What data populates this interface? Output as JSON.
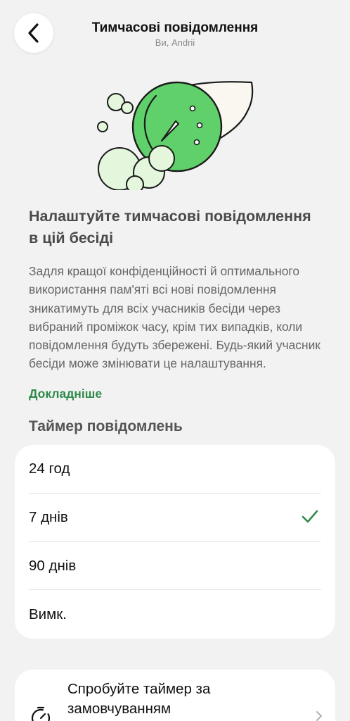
{
  "header": {
    "title": "Тимчасові повідомлення",
    "subtitle": "Ви, Andrii"
  },
  "intro": {
    "heading": "Налаштуйте тимчасові повідомлення в цій бесіді",
    "body": "Задля кращої конфіденційності й оптимального використання пам'яті всі нові повідомлення зникатимуть для всіх учасників бесіди через вибраний проміжок часу, крім тих випадків, коли повідомлення будуть збережені. Будь-який учасник бесіди може змінювати це налаштування.",
    "learn_more": "Докладніше"
  },
  "timer": {
    "heading": "Таймер повідомлень",
    "options": [
      {
        "label": "24 год",
        "selected": false
      },
      {
        "label": "7 днів",
        "selected": true
      },
      {
        "label": "90 днів",
        "selected": false
      },
      {
        "label": "Вимк.",
        "selected": false
      }
    ]
  },
  "default_timer": {
    "label": "Спробуйте таймер за замовчуванням"
  },
  "colors": {
    "accent_green": "#2f8a4a",
    "illustration_green": "#5fd06a",
    "illustration_light": "#e4f7dc"
  }
}
